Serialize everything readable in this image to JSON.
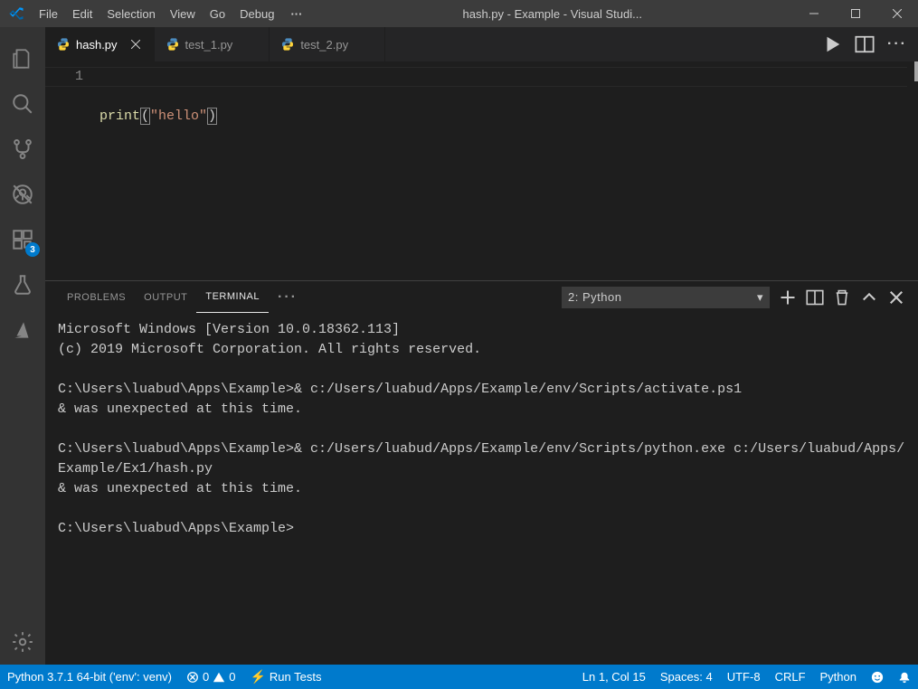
{
  "titlebar": {
    "menus": [
      "File",
      "Edit",
      "Selection",
      "View",
      "Go",
      "Debug"
    ],
    "title": "hash.py - Example - Visual Studi..."
  },
  "activitybar": {
    "badge_count": "3"
  },
  "tabs": [
    {
      "label": "hash.py",
      "active": true
    },
    {
      "label": "test_1.py",
      "active": false
    },
    {
      "label": "test_2.py",
      "active": false
    }
  ],
  "editor": {
    "line_number": "1",
    "tok_fn": "print",
    "tok_lp": "(",
    "tok_str": "\"hello\"",
    "tok_rp": ")"
  },
  "panel": {
    "tabs": {
      "problems": "Problems",
      "output": "Output",
      "terminal": "Terminal"
    },
    "terminal_select": "2: Python",
    "terminal_text": "Microsoft Windows [Version 10.0.18362.113]\n(c) 2019 Microsoft Corporation. All rights reserved.\n\nC:\\Users\\luabud\\Apps\\Example>& c:/Users/luabud/Apps/Example/env/Scripts/activate.ps1\n& was unexpected at this time.\n\nC:\\Users\\luabud\\Apps\\Example>& c:/Users/luabud/Apps/Example/env/Scripts/python.exe c:/Users/luabud/Apps/Example/Ex1/hash.py\n& was unexpected at this time.\n\nC:\\Users\\luabud\\Apps\\Example>"
  },
  "statusbar": {
    "interpreter": "Python 3.7.1 64-bit ('env': venv)",
    "errors": "0",
    "warnings": "0",
    "run_tests": "Run Tests",
    "ln_col": "Ln 1, Col 15",
    "spaces": "Spaces: 4",
    "encoding": "UTF-8",
    "eol": "CRLF",
    "language": "Python"
  }
}
